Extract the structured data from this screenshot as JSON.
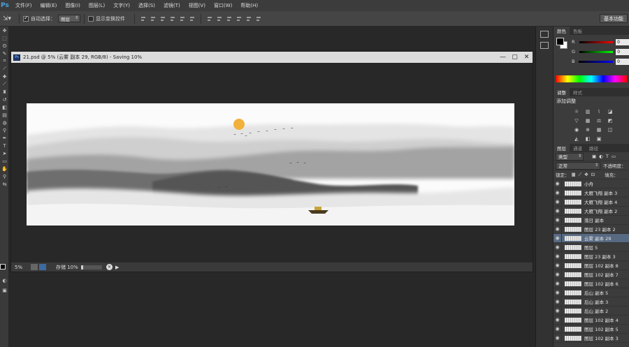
{
  "menubar": {
    "logo": "Ps",
    "items": [
      "文件(F)",
      "编辑(E)",
      "图像(I)",
      "图层(L)",
      "文字(Y)",
      "选择(S)",
      "滤镜(T)",
      "视图(V)",
      "窗口(W)",
      "帮助(H)"
    ]
  },
  "options": {
    "auto_select_label": "自动选择：",
    "auto_select_checked": true,
    "target_value": "图层",
    "transform_label": "显示变换控件",
    "workspace": "基本功能"
  },
  "document": {
    "title": "21.psd @ 5% (云雾 副本 29, RGB/8) - Saving 10%",
    "zoom": "5%",
    "status": "存储 10%",
    "save_progress": 0.1
  },
  "color_panel": {
    "tabs": [
      "颜色",
      "色板"
    ],
    "channels": [
      {
        "label": "R",
        "value": "0"
      },
      {
        "label": "G",
        "value": "0"
      },
      {
        "label": "B",
        "value": "0"
      }
    ]
  },
  "adjust_panel": {
    "tabs": [
      "调整",
      "样式"
    ],
    "heading": "添加调整"
  },
  "layers_panel": {
    "tabs": [
      "图层",
      "通道",
      "路径"
    ],
    "kind": "类型",
    "blend_mode": "正常",
    "opacity_label": "不透明度：",
    "lock_label": "锁定：",
    "fill_label": "填充：",
    "selected_index": 6,
    "layers": [
      "小舟",
      "大雁飞翔 副本 3",
      "大雁飞翔 副本 4",
      "大雁飞翔 副本 2",
      "落日 副本",
      "图层 23 副本 2",
      "云雾 副本 29",
      "图层 5",
      "图层 23 副本 3",
      "图层 102 副本 8",
      "图层 102 副本 7",
      "图层 102 副本 6",
      "后山 副本 5",
      "后山 副本 3",
      "后山 副本 2",
      "图层 102 副本 4",
      "图层 102 副本 5",
      "图层 102 副本 3"
    ]
  },
  "colors": {
    "menubar_bg": "#3c3c3c",
    "panel_bg": "#3c3c3c",
    "selected_layer": "#586a82",
    "sun": "#f2b13a"
  }
}
